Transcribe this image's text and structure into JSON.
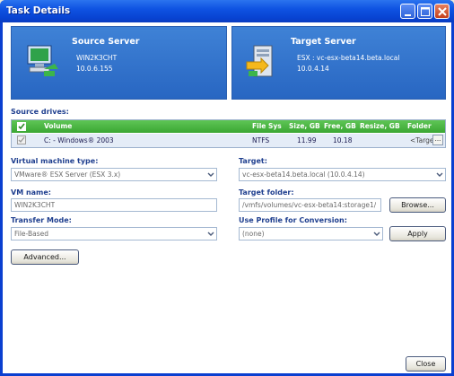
{
  "window": {
    "title": "Task Details"
  },
  "source_server": {
    "heading": "Source Server",
    "name": "WIN2K3CHT",
    "ip": "10.0.6.155"
  },
  "target_server": {
    "heading": "Target Server",
    "name": "ESX : vc-esx-beta14.beta.local",
    "ip": "10.0.4.14"
  },
  "source_drives": {
    "label": "Source drives:",
    "columns": [
      "Volume",
      "File Sys",
      "Size, GB",
      "Free, GB",
      "Resize, GB",
      "Folder"
    ],
    "rows": [
      {
        "volume": "C: - Windows® 2003",
        "file_sys": "NTFS",
        "size": "11.99",
        "free": "10.18",
        "resize": "",
        "folder": "<Target"
      }
    ],
    "folder_button": "..."
  },
  "form": {
    "vm_type_label": "Virtual machine type:",
    "vm_type_value": "VMware® ESX Server (ESX 3.x)",
    "target_label": "Target:",
    "target_value": "vc-esx-beta14.beta.local (10.0.4.14)",
    "vm_name_label": "VM name:",
    "vm_name_value": "WIN2K3CHT",
    "target_folder_label": "Target folder:",
    "target_folder_value": "/vmfs/volumes/vc-esx-beta14:storage1/",
    "browse_label": "Browse...",
    "transfer_mode_label": "Transfer Mode:",
    "transfer_mode_value": "File-Based",
    "profile_label": "Use Profile for Conversion:",
    "profile_value": "(none)",
    "apply_label": "Apply",
    "advanced_label": "Advanced..."
  },
  "footer": {
    "close_label": "Close"
  },
  "colors": {
    "title_bar": "#0a3fd0",
    "server_panel": "#2f6fcb",
    "grid_header": "#47b03f",
    "label_blue": "#1f3f8f"
  },
  "icons": [
    "source-server-icon",
    "target-server-icon",
    "minimize-icon",
    "maximize-icon",
    "close-icon",
    "checkbox-icon",
    "dropdown-arrow-icon"
  ]
}
